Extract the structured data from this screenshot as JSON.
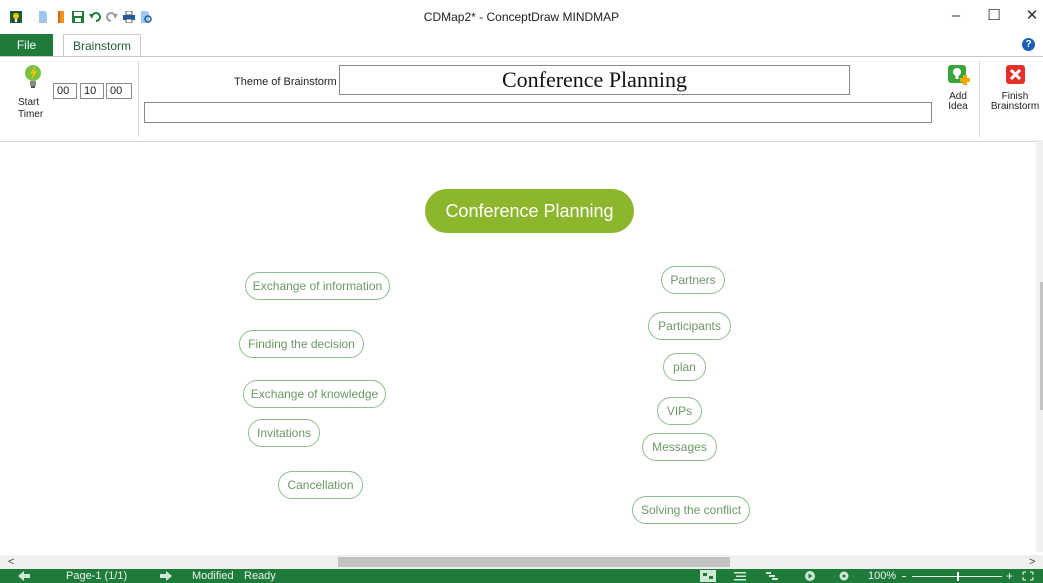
{
  "window": {
    "title": "CDMap2* - ConceptDraw MINDMAP",
    "minimize_glyph": "–",
    "maximize_glyph": "☐",
    "close_glyph": "✕"
  },
  "tabs": {
    "file": "File",
    "brainstorm": "Brainstorm",
    "help": "?"
  },
  "ribbon": {
    "start_timer_line1": "Start",
    "start_timer_line2": "Timer",
    "timer": {
      "hours": "00",
      "minutes": "10",
      "seconds": "00"
    },
    "theme_label": "Theme of Brainstorm",
    "theme_value": "Conference Planning",
    "idea_input_value": "",
    "add_idea_line1": "Add",
    "add_idea_line2": "Idea",
    "finish_line1": "Finish",
    "finish_line2": "Brainstorm"
  },
  "map": {
    "main_topic": "Conference Planning",
    "left_ideas": [
      "Exchange of information",
      "Finding the decision",
      "Exchange of knowledge",
      "Invitations",
      "Cancellation"
    ],
    "right_ideas": [
      "Partners",
      "Participants",
      "plan",
      "VIPs",
      "Messages",
      "Solving the conflict"
    ]
  },
  "scrollbar": {
    "left_arrow": "<",
    "right_arrow": ">"
  },
  "status": {
    "page": "Page-1 (1/1)",
    "modified": "Modified",
    "ready": "Ready",
    "zoom": "100%"
  },
  "colors": {
    "accent_green": "#1e7b3a",
    "topic_green": "#8cb62b",
    "idea_border": "#8cc08c",
    "idea_text": "#6a9a63"
  }
}
